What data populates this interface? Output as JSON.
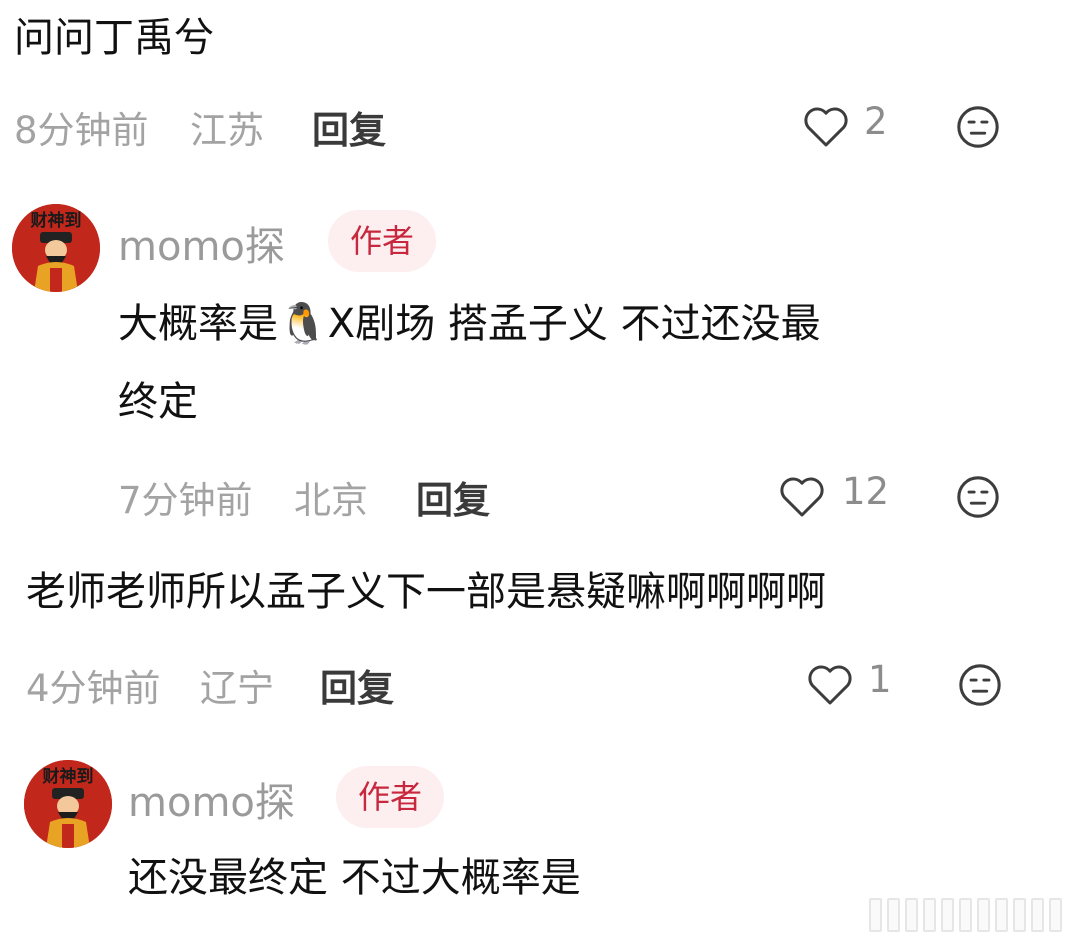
{
  "comment_1": {
    "text": "问问丁禹兮",
    "time": "8分钟前",
    "location": "江苏",
    "reply_label": "回复",
    "likes": "2"
  },
  "reply_1": {
    "username": "momo探",
    "badge": "作者",
    "text_line_1": "大概率是🐧X剧场 搭孟子义 不过还没最",
    "text_line_2": "终定",
    "time": "7分钟前",
    "location": "北京",
    "reply_label": "回复",
    "likes": "12"
  },
  "comment_2": {
    "text": "老师老师所以孟子义下一部是悬疑嘛啊啊啊啊",
    "time": "4分钟前",
    "location": "辽宁",
    "reply_label": "回复",
    "likes": "1"
  },
  "reply_2": {
    "username": "momo探",
    "badge": "作者",
    "text": "还没最终定 不过大概率是"
  },
  "avatar": {
    "text": "财神到"
  },
  "colors": {
    "author_badge_bg": "#fdeef0",
    "author_badge_text": "#c8283d",
    "meta_gray": "#a3a3a3",
    "avatar_red": "#c2271b"
  },
  "icons": [
    "heart-icon",
    "meh-face-icon",
    "penguin-emoji"
  ]
}
